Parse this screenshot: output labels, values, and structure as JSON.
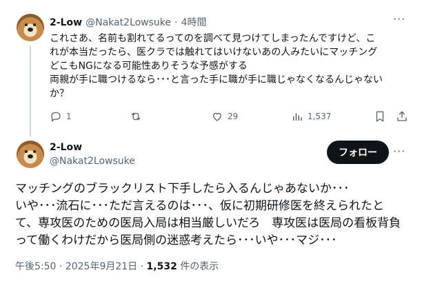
{
  "post1": {
    "display_name": "2-Low",
    "handle": "@Nakat2Lowsuke",
    "separator": "·",
    "time": "4時間",
    "text_lines": [
      "これさあ、名前も割れてるってのを調べて見つけてしまったんですけど、こ",
      "れが本当だったら、医クラでは触れてはいけないあの人みたいにマッチング",
      "どこもNGになる可能性ありそうな予感がする",
      "両親が手に職つけるなら･･･と言った手に職が手に職じゃなくなるんじゃない",
      "か？"
    ],
    "actions": {
      "replies": "1",
      "reposts": "",
      "likes": "29",
      "views": "1,537"
    }
  },
  "post2": {
    "display_name": "2-Low",
    "handle": "@Nakat2Lowsuke",
    "follow_label": "フォロー",
    "text_lines": [
      "マッチングのブラックリスト下手したら入るんじゃあないか･･･",
      "いや･･･流石に･･･ただ言えるのは･･･、仮に初期研修医を終えられたと",
      "て、専攻医のための医局入局は相当厳しいだろ　専攻医は医局の看板背負",
      "って働くわけだから医局側の迷惑考えたら･･･いや･･･マジ･･･"
    ],
    "time": "午後5:50",
    "date": "2025年9月21日",
    "views_count": "1,532",
    "views_label": "件の表示"
  },
  "more_glyph": "···"
}
